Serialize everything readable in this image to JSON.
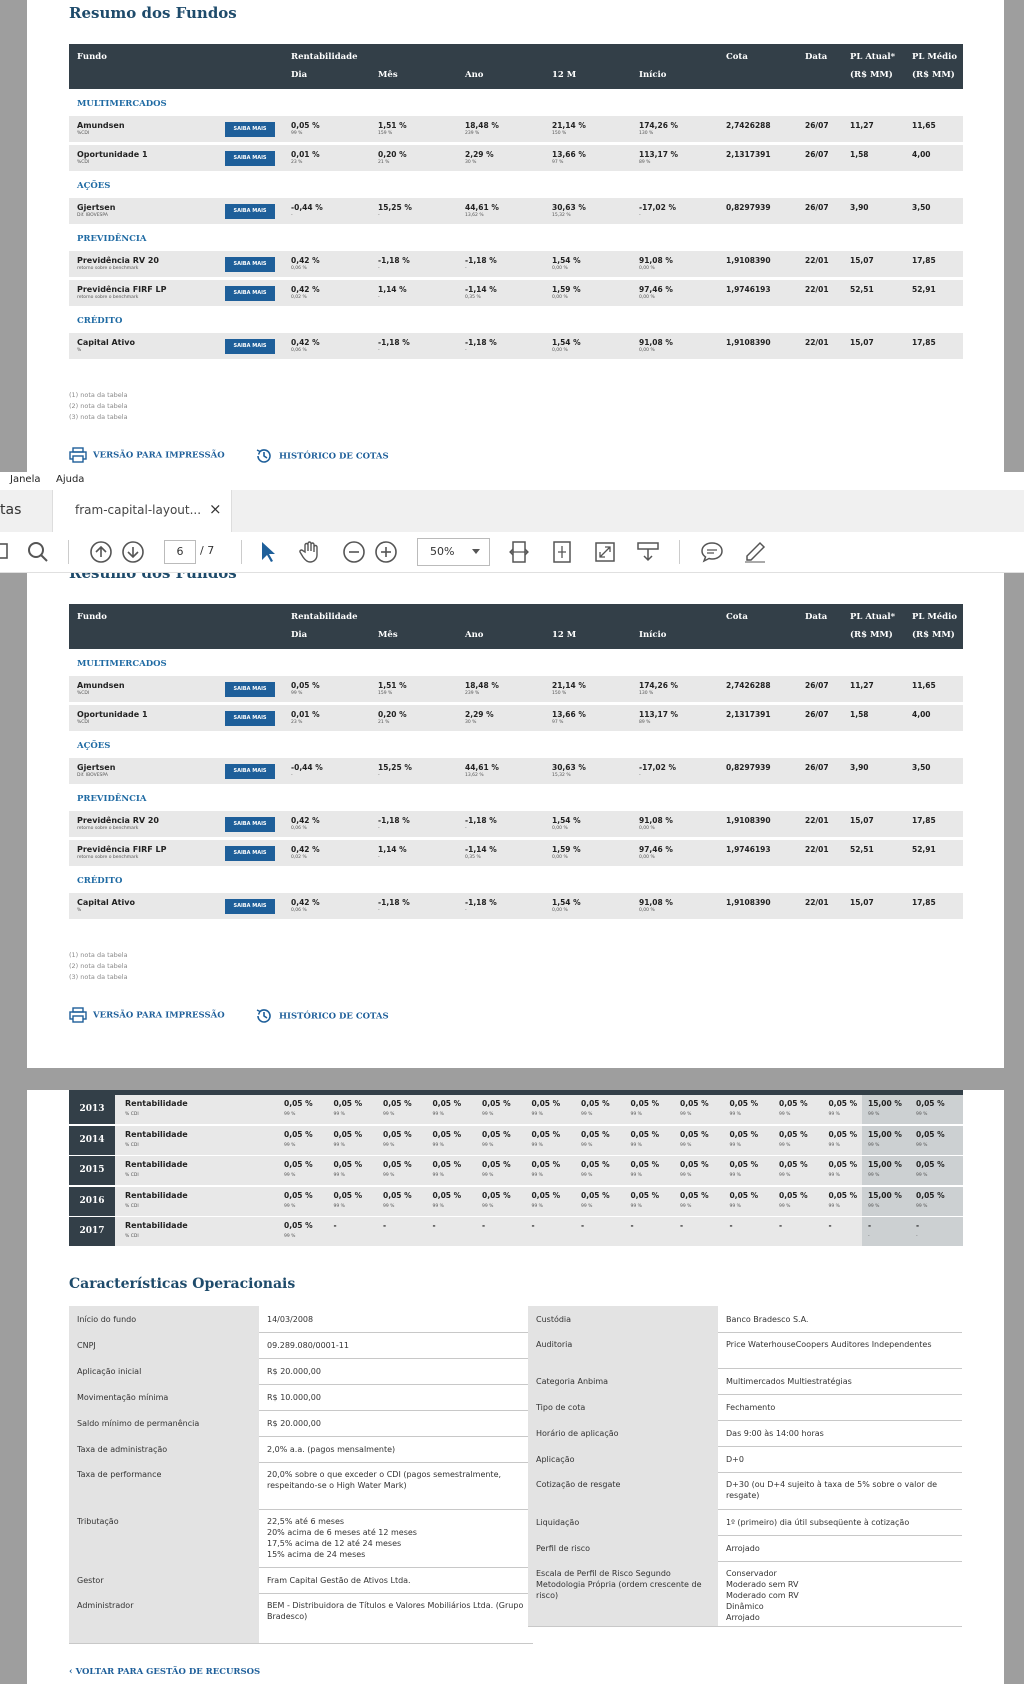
{
  "title": "Resumo dos Fundos",
  "headers": {
    "fundo": "Fundo",
    "rentabilidade": "Rentabilidade",
    "dia": "Dia",
    "mes": "Mês",
    "ano": "Ano",
    "m12": "12 M",
    "inicio": "Início",
    "cota": "Cota",
    "data": "Data",
    "pl_atual": "PL Atual*",
    "pl_atual_unit": "(R$ MM)",
    "pl_medio": "PL Médio",
    "pl_medio_unit": "(R$ MM)"
  },
  "saiba": "SAIBA MAIS",
  "categories": [
    {
      "name": "MULTIMERCADOS",
      "funds": [
        {
          "name": "Amundsen",
          "sub": "%CDI",
          "dia": "0,05 %",
          "dia_s": "99 %",
          "mes": "1,51 %",
          "mes_s": "159 %",
          "ano": "18,48 %",
          "ano_s": "239 %",
          "m12": "21,14 %",
          "m12_s": "150 %",
          "inicio": "174,26 %",
          "inicio_s": "130 %",
          "cota": "2,7426288",
          "data": "26/07",
          "pl": "11,27",
          "plm": "11,65"
        },
        {
          "name": "Oportunidade 1",
          "sub": "%CDI",
          "dia": "0,01 %",
          "dia_s": "23 %",
          "mes": "0,20 %",
          "mes_s": "21 %",
          "ano": "2,29 %",
          "ano_s": "30 %",
          "m12": "13,66 %",
          "m12_s": "97 %",
          "inicio": "113,17 %",
          "inicio_s": "89 %",
          "cota": "2,1317391",
          "data": "26/07",
          "pl": "1,58",
          "plm": "4,00"
        }
      ]
    },
    {
      "name": "AÇÕES",
      "funds": [
        {
          "name": "Gjertsen",
          "sub": "Dif. IBOVESPA",
          "dia": "-0,44 %",
          "dia_s": "-",
          "mes": "15,25 %",
          "mes_s": "-",
          "ano": "44,61 %",
          "ano_s": "13,62 %",
          "m12": "30,63 %",
          "m12_s": "15,32 %",
          "inicio": "-17,02 %",
          "inicio_s": "-",
          "cota": "0,8297939",
          "data": "26/07",
          "pl": "3,90",
          "plm": "3,50"
        }
      ]
    },
    {
      "name": "PREVIDÊNCIA",
      "funds": [
        {
          "name": "Previdência RV 20",
          "sub": "retorno sobre o benchmark",
          "dia": "0,42 %",
          "dia_s": "0,06 %",
          "mes": "-1,18 %",
          "mes_s": "-",
          "ano": "-1,18 %",
          "ano_s": "-",
          "m12": "1,54 %",
          "m12_s": "0,00 %",
          "inicio": "91,08 %",
          "inicio_s": "0,00 %",
          "cota": "1,9108390",
          "data": "22/01",
          "pl": "15,07",
          "plm": "17,85"
        },
        {
          "name": "Previdência FIRF LP",
          "sub": "retorno sobre o benchmark",
          "dia": "0,42 %",
          "dia_s": "0,02 %",
          "mes": "1,14 %",
          "mes_s": "-",
          "ano": "-1,14 %",
          "ano_s": "0,35 %",
          "m12": "1,59 %",
          "m12_s": "0,00 %",
          "inicio": "97,46 %",
          "inicio_s": "0,00 %",
          "cota": "1,9746193",
          "data": "22/01",
          "pl": "52,51",
          "plm": "52,91"
        }
      ]
    },
    {
      "name": "CRÉDITO",
      "funds": [
        {
          "name": "Capital Ativo",
          "sub": "%",
          "dia": "0,42 %",
          "dia_s": "0,06 %",
          "mes": "-1,18 %",
          "mes_s": "-",
          "ano": "-1,18 %",
          "ano_s": "-",
          "m12": "1,54 %",
          "m12_s": "0,00 %",
          "inicio": "91,08 %",
          "inicio_s": "0,00 %",
          "cota": "1,9108390",
          "data": "22/01",
          "pl": "15,07",
          "plm": "17,85"
        }
      ]
    }
  ],
  "notes": [
    "(1) nota da tabela",
    "(2) nota da tabela",
    "(3) nota da tabela"
  ],
  "print_link": "VERSÃO PARA IMPRESSÃO",
  "history_link": "HISTÓRICO DE COTAS",
  "viewer": {
    "menu_janela": "Janela",
    "menu_ajuda": "Ajuda",
    "tab_left": "tas",
    "tab_title": "fram-capital-layout...",
    "tab_close": "×",
    "page": "6",
    "page_total": "/ 7",
    "zoom": "50%"
  },
  "monthly": {
    "label": "Rentabilidade",
    "sub": "% CDI",
    "years": [
      {
        "year": "2013",
        "vals": [
          "0,05 %",
          "0,05 %",
          "0,05 %",
          "0,05 %",
          "0,05 %",
          "0,05 %",
          "0,05 %",
          "0,05 %",
          "0,05 %",
          "0,05 %",
          "0,05 %",
          "0,05 %",
          "15,00 %",
          "0,05 %"
        ],
        "subs": [
          "99 %",
          "99 %",
          "99 %",
          "99 %",
          "99 %",
          "99 %",
          "99 %",
          "99 %",
          "99 %",
          "99 %",
          "99 %",
          "99 %",
          "99 %",
          "99 %"
        ]
      },
      {
        "year": "2014",
        "vals": [
          "0,05 %",
          "0,05 %",
          "0,05 %",
          "0,05 %",
          "0,05 %",
          "0,05 %",
          "0,05 %",
          "0,05 %",
          "0,05 %",
          "0,05 %",
          "0,05 %",
          "0,05 %",
          "15,00 %",
          "0,05 %"
        ],
        "subs": [
          "99 %",
          "99 %",
          "99 %",
          "99 %",
          "99 %",
          "99 %",
          "99 %",
          "99 %",
          "99 %",
          "99 %",
          "99 %",
          "99 %",
          "99 %",
          "99 %"
        ]
      },
      {
        "year": "2015",
        "vals": [
          "0,05 %",
          "0,05 %",
          "0,05 %",
          "0,05 %",
          "0,05 %",
          "0,05 %",
          "0,05 %",
          "0,05 %",
          "0,05 %",
          "0,05 %",
          "0,05 %",
          "0,05 %",
          "15,00 %",
          "0,05 %"
        ],
        "subs": [
          "99 %",
          "99 %",
          "99 %",
          "99 %",
          "99 %",
          "99 %",
          "99 %",
          "99 %",
          "99 %",
          "99 %",
          "99 %",
          "99 %",
          "99 %",
          "99 %"
        ]
      },
      {
        "year": "2016",
        "vals": [
          "0,05 %",
          "0,05 %",
          "0,05 %",
          "0,05 %",
          "0,05 %",
          "0,05 %",
          "0,05 %",
          "0,05 %",
          "0,05 %",
          "0,05 %",
          "0,05 %",
          "0,05 %",
          "15,00 %",
          "0,05 %"
        ],
        "subs": [
          "99 %",
          "99 %",
          "99 %",
          "99 %",
          "99 %",
          "99 %",
          "99 %",
          "99 %",
          "99 %",
          "99 %",
          "99 %",
          "99 %",
          "99 %",
          "99 %"
        ]
      },
      {
        "year": "2017",
        "vals": [
          "0,05 %",
          "-",
          "-",
          "-",
          "-",
          "-",
          "-",
          "-",
          "-",
          "-",
          "-",
          "-",
          "-",
          "-"
        ],
        "subs": [
          "99 %",
          "",
          "",
          "",
          "",
          "",
          "",
          "",
          "",
          "",
          "",
          "",
          "-",
          "-"
        ]
      }
    ]
  },
  "ops_title": "Características Operacionais",
  "ops_left": [
    {
      "label": "Início do fundo",
      "value": "14/03/2008"
    },
    {
      "label": "CNPJ",
      "value": "09.289.080/0001-11"
    },
    {
      "label": "Aplicação inicial",
      "value": "R$ 20.000,00"
    },
    {
      "label": "Movimentação mínima",
      "value": "R$ 10.000,00"
    },
    {
      "label": "Saldo mínimo de permanência",
      "value": "R$ 20.000,00"
    },
    {
      "label": "Taxa de administração",
      "value": "2,0% a.a. (pagos mensalmente)"
    },
    {
      "label": "Taxa de performance",
      "value": "20,0% sobre o que exceder o CDI (pagos semestralmente, respeitando-se o High Water Mark)"
    },
    {
      "label": "Tributação",
      "value": "22,5% até 6 meses\n20% acima de 6 meses até 12 meses\n17,5% acima de 12 até 24 meses\n15% acima de 24 meses"
    },
    {
      "label": "Gestor",
      "value": "Fram Capital Gestão de Ativos Ltda."
    },
    {
      "label": "Administrador",
      "value": "BEM - Distribuidora de Títulos e Valores Mobiliários Ltda. (Grupo Bradesco)"
    }
  ],
  "ops_right": [
    {
      "label": "Custódia",
      "value": "Banco Bradesco S.A."
    },
    {
      "label": "Auditoria",
      "value": "Price WaterhouseCoopers Auditores Independentes"
    },
    {
      "label": "Categoria Anbima",
      "value": "Multimercados Multiestratégias"
    },
    {
      "label": "Tipo de cota",
      "value": "Fechamento"
    },
    {
      "label": "Horário de aplicação",
      "value": "Das 9:00 às 14:00 horas"
    },
    {
      "label": "Aplicação",
      "value": "D+0"
    },
    {
      "label": "Cotização de resgate",
      "value": "D+30 (ou D+4 sujeito à taxa de 5% sobre o valor de resgate)"
    },
    {
      "label": "Liquidação",
      "value": "1º (primeiro) dia útil subseqüente à cotização"
    },
    {
      "label": "Perfil de risco",
      "value": "Arrojado"
    },
    {
      "label": "Escala de Perfil de Risco Segundo Metodologia Própria (ordem crescente de risco)",
      "value": "Conservador\nModerado sem RV\nModerado com RV\nDinâmico\nArrojado"
    }
  ],
  "back_link": "VOLTAR PARA GESTÃO DE RECURSOS",
  "colors": {
    "header": "#333f48",
    "accent": "#1e5f9a",
    "title": "#1e4b6b",
    "row": "#e8e8e8"
  }
}
